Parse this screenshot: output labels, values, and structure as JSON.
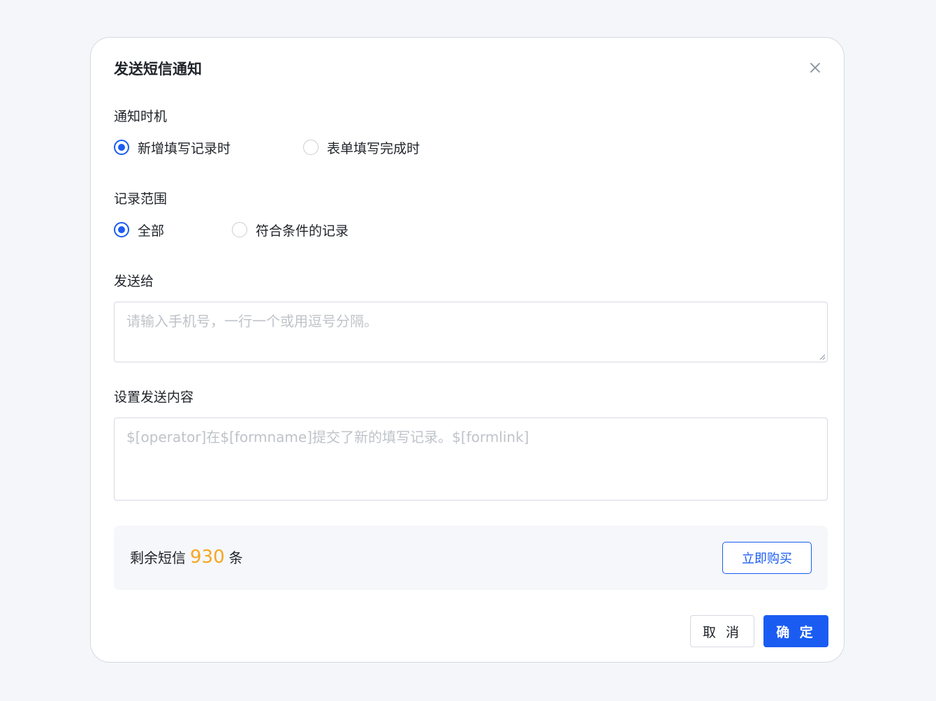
{
  "dialog": {
    "title": "发送短信通知",
    "close_icon": "close-icon"
  },
  "notify_timing": {
    "label": "通知时机",
    "options": [
      {
        "label": "新增填写记录时",
        "checked": true
      },
      {
        "label": "表单填写完成时",
        "checked": false
      }
    ]
  },
  "record_scope": {
    "label": "记录范围",
    "options": [
      {
        "label": "全部",
        "checked": true
      },
      {
        "label": "符合条件的记录",
        "checked": false
      }
    ]
  },
  "send_to": {
    "label": "发送给",
    "value": "",
    "placeholder": "请输入手机号，一行一个或用逗号分隔。"
  },
  "content": {
    "label": "设置发送内容",
    "value": "",
    "placeholder": "$[operator]在$[formname]提交了新的填写记录。$[formlink]"
  },
  "quota": {
    "prefix": "剩余短信",
    "count": "930",
    "suffix": "条",
    "buy_label": "立即购买"
  },
  "footer": {
    "cancel_label": "取 消",
    "ok_label": "确 定"
  },
  "colors": {
    "primary": "#1a5cf2",
    "count_highlight": "#f5a623"
  }
}
